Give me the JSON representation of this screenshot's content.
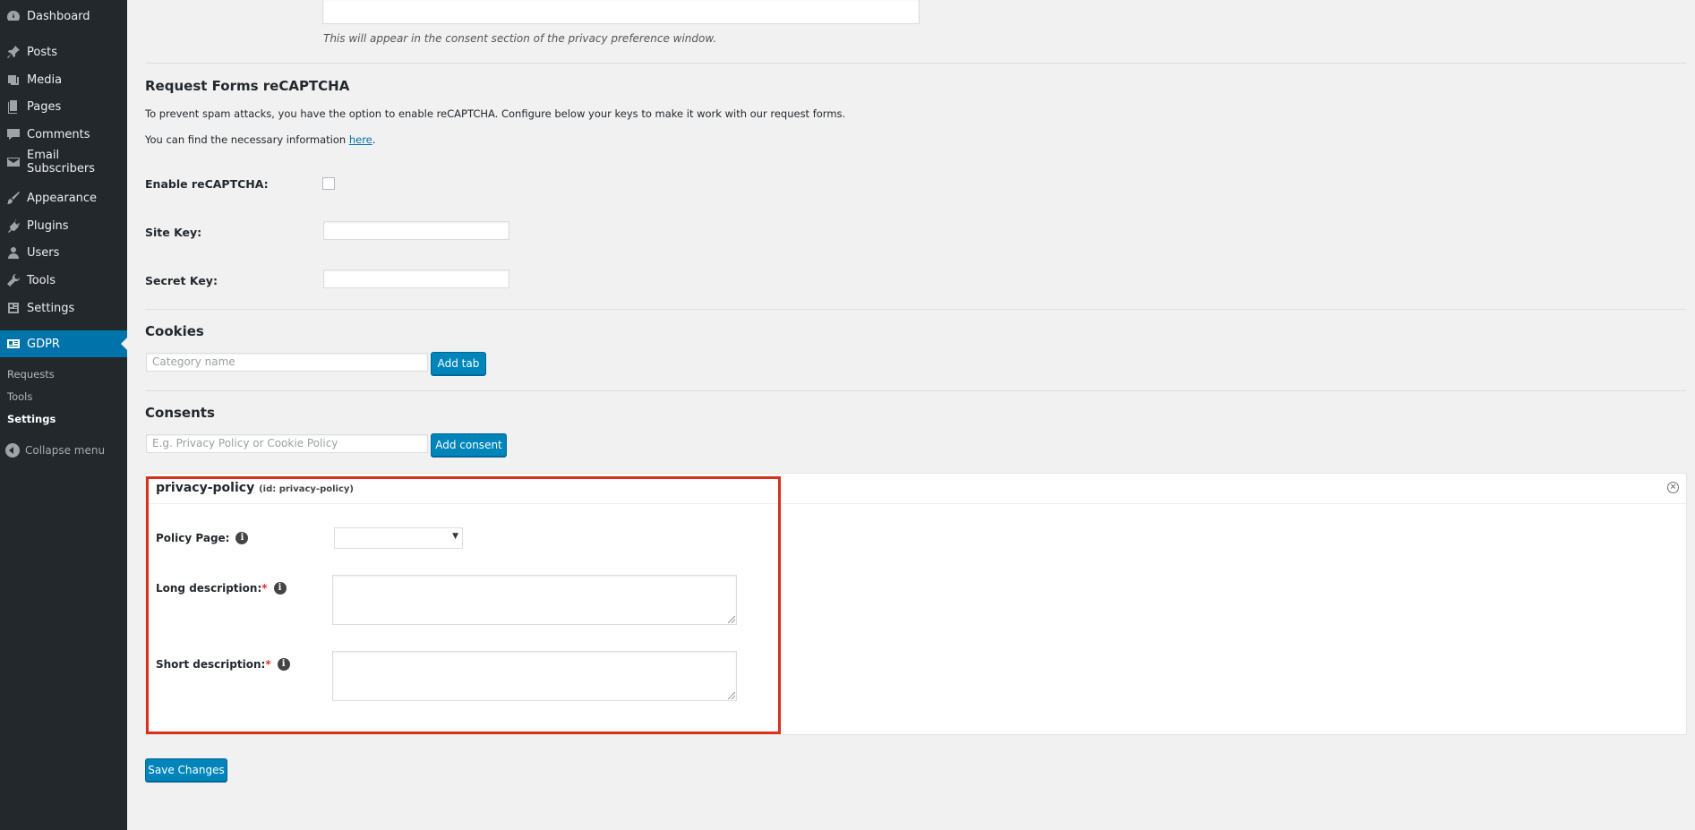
{
  "sidebar": {
    "items": [
      {
        "label": "Dashboard",
        "icon": "dashboard-icon"
      },
      {
        "label": "Posts",
        "icon": "pin-icon"
      },
      {
        "label": "Media",
        "icon": "media-icon"
      },
      {
        "label": "Pages",
        "icon": "pages-icon"
      },
      {
        "label": "Comments",
        "icon": "comment-icon"
      },
      {
        "label": "Email Subscribers",
        "icon": "email-icon"
      },
      {
        "label": "Appearance",
        "icon": "brush-icon"
      },
      {
        "label": "Plugins",
        "icon": "plugin-icon"
      },
      {
        "label": "Users",
        "icon": "user-icon"
      },
      {
        "label": "Tools",
        "icon": "wrench-icon"
      },
      {
        "label": "Settings",
        "icon": "settings-icon"
      },
      {
        "label": "GDPR",
        "icon": "id-card-icon"
      }
    ],
    "submenu": [
      "Requests",
      "Tools",
      "Settings"
    ],
    "collapse": "Collapse menu"
  },
  "main": {
    "consent_hint": "This will appear in the consent section of the privacy preference window.",
    "recaptcha": {
      "title": "Request Forms reCAPTCHA",
      "desc": "To prevent spam attacks, you have the option to enable reCAPTCHA. Configure below your keys to make it work with our request forms.",
      "info_prefix": "You can find the necessary information ",
      "info_link": "here",
      "info_suffix": ".",
      "enable_label": "Enable reCAPTCHA:",
      "site_key_label": "Site Key:",
      "secret_key_label": "Secret Key:",
      "site_key_value": "",
      "secret_key_value": ""
    },
    "cookies": {
      "title": "Cookies",
      "placeholder": "Category name",
      "button": "Add tab"
    },
    "consents": {
      "title": "Consents",
      "placeholder": "E.g. Privacy Policy or Cookie Policy",
      "button": "Add consent"
    },
    "panel": {
      "title": "privacy-policy",
      "id_note": "(id: privacy-policy)",
      "policy_page_label": "Policy Page:",
      "long_desc_label": "Long description:",
      "short_desc_label": "Short description:",
      "required_mark": "*",
      "info_glyph": "i",
      "close_glyph": "×",
      "select_arrow": "▼"
    },
    "save_button": "Save Changes"
  },
  "colors": {
    "sidebar_bg": "#23282d",
    "active": "#0073aa",
    "button": "#0085ba",
    "highlight": "#d9301d"
  }
}
